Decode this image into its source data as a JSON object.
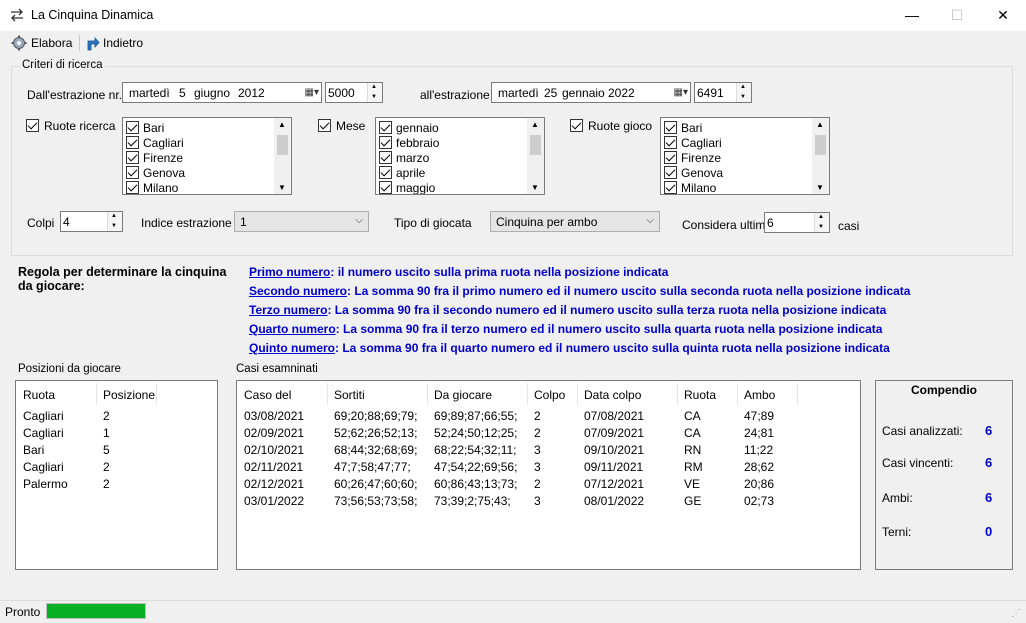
{
  "window": {
    "title": "La Cinquina Dinamica",
    "minimize": "—",
    "maximize": "☐",
    "close": "✕"
  },
  "toolbar": {
    "elabora": "Elabora",
    "indietro": "Indietro"
  },
  "criteria": {
    "group_label": "Criteri di ricerca",
    "from_label": "Dall'estrazione nr.",
    "from_date": {
      "weekday": "martedì",
      "day": "5",
      "month": "giugno",
      "year": "2012"
    },
    "from_number": "5000",
    "to_label": "all'estrazione",
    "to_date": {
      "weekday": "martedì",
      "day": "25",
      "month": "gennaio",
      "year": "2022"
    },
    "to_number": "6491",
    "ruote_ricerca_label": "Ruote ricerca",
    "ruote_ricerca_items": [
      "Bari",
      "Cagliari",
      "Firenze",
      "Genova",
      "Milano"
    ],
    "mese_label": "Mese",
    "mese_items": [
      "gennaio",
      "febbraio",
      "marzo",
      "aprile",
      "maggio"
    ],
    "ruote_gioco_label": "Ruote gioco",
    "ruote_gioco_items": [
      "Bari",
      "Cagliari",
      "Firenze",
      "Genova",
      "Milano"
    ],
    "colpi_label": "Colpi",
    "colpi_value": "4",
    "indice_label": "Indice estrazione",
    "indice_value": "1",
    "tipo_label": "Tipo di giocata",
    "tipo_value": "Cinquina per ambo",
    "considera_label": "Considera ultimi",
    "considera_value": "6",
    "casi_label": "casi"
  },
  "rules": {
    "heading": "Regola per determinare la cinquina da giocare:",
    "lines": [
      {
        "u": "Primo numero",
        "rest": ": il numero uscito sulla prima ruota nella posizione indicata"
      },
      {
        "u": "Secondo numero",
        "rest": ": La somma 90 fra il primo numero ed il numero uscito sulla seconda ruota nella posizione indicata"
      },
      {
        "u": "Terzo numero",
        "rest": ": La somma 90 fra il secondo numero ed il numero uscito sulla terza ruota nella posizione indicata"
      },
      {
        "u": "Quarto numero",
        "rest": ": La somma 90 fra il terzo numero ed il numero uscito sulla quarta ruota nella posizione indicata"
      },
      {
        "u": "Quinto numero",
        "rest": ": La somma 90 fra il quarto numero ed il numero uscito sulla quinta ruota nella posizione indicata"
      }
    ]
  },
  "posizioni": {
    "label": "Posizioni da giocare",
    "headers": [
      "Ruota",
      "Posizione"
    ],
    "rows": [
      [
        "Cagliari",
        "2"
      ],
      [
        "Cagliari",
        "1"
      ],
      [
        "Bari",
        "5"
      ],
      [
        "Cagliari",
        "2"
      ],
      [
        "Palermo",
        "2"
      ]
    ]
  },
  "casi": {
    "label": "Casi esamninati",
    "headers": [
      "Caso del",
      "Sortiti",
      "Da giocare",
      "Colpo",
      "Data colpo",
      "Ruota",
      "Ambo"
    ],
    "rows": [
      [
        "03/08/2021",
        "69;20;88;69;79;",
        "69;89;87;66;55;",
        "2",
        "07/08/2021",
        "CA",
        "47;89"
      ],
      [
        "02/09/2021",
        "52;62;26;52;13;",
        "52;24;50;12;25;",
        "2",
        "07/09/2021",
        "CA",
        "24;81"
      ],
      [
        "02/10/2021",
        "68;44;32;68;69;",
        "68;22;54;32;11;",
        "3",
        "09/10/2021",
        "RN",
        "11;22"
      ],
      [
        "02/11/2021",
        "47;7;58;47;77;",
        "47;54;22;69;56;",
        "3",
        "09/11/2021",
        "RM",
        "28;62"
      ],
      [
        "02/12/2021",
        "60;26;47;60;60;",
        "60;86;43;13;73;",
        "2",
        "07/12/2021",
        "VE",
        "20;86"
      ],
      [
        "03/01/2022",
        "73;56;53;73;58;",
        "73;39;2;75;43;",
        "3",
        "08/01/2022",
        "GE",
        "02;73"
      ]
    ]
  },
  "compendio": {
    "title": "Compendio",
    "items": [
      {
        "label": "Casi analizzati:",
        "value": "6"
      },
      {
        "label": "Casi vincenti:",
        "value": "6"
      },
      {
        "label": "Ambi:",
        "value": "6"
      },
      {
        "label": "Terni:",
        "value": "0"
      }
    ]
  },
  "status": {
    "text": "Pronto",
    "progress": 1.0,
    "progress_color": "#06b025"
  }
}
